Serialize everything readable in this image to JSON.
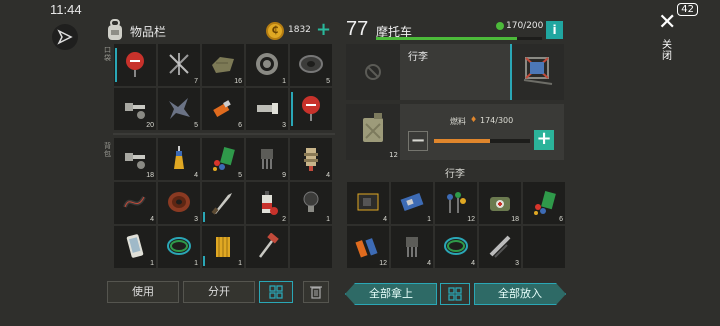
{
  "status": {
    "time": "11:44",
    "battery": "42"
  },
  "inventory": {
    "title": "物品栏",
    "coins": "1832",
    "label_pockets": "口袋",
    "label_backpack": "背包",
    "pockets": [
      {
        "icon": "stop-sign-icon",
        "count": ""
      },
      {
        "icon": "nails-icon",
        "count": "7"
      },
      {
        "icon": "cloth-icon",
        "count": "16"
      },
      {
        "icon": "bearing-icon",
        "count": "1"
      },
      {
        "icon": "tire-icon",
        "count": "5"
      },
      {
        "icon": "bolts-icon",
        "count": "20"
      },
      {
        "icon": "scrap-metal-icon",
        "count": "5"
      },
      {
        "icon": "usb-drive-icon",
        "count": "6"
      },
      {
        "icon": "flashlight-icon",
        "count": "3"
      },
      {
        "icon": "stop-sign-icon",
        "count": ""
      }
    ],
    "backpack": [
      {
        "icon": "bolts-icon",
        "count": "18"
      },
      {
        "icon": "glue-icon",
        "count": "4"
      },
      {
        "icon": "chemicals-icon",
        "count": "5"
      },
      {
        "icon": "transistor-icon",
        "count": "9"
      },
      {
        "icon": "engine-part-icon",
        "count": "4"
      },
      {
        "icon": "cable-icon",
        "count": "4"
      },
      {
        "icon": "copper-coil-icon",
        "count": "3"
      },
      {
        "icon": "machete-icon",
        "count": ""
      },
      {
        "icon": "spray-paint-icon",
        "count": "2"
      },
      {
        "icon": "light-bulb-icon",
        "count": "1"
      },
      {
        "icon": "smartphone-icon",
        "count": "1"
      },
      {
        "icon": "wire-icon",
        "count": "1"
      },
      {
        "icon": "filter-icon",
        "count": "1"
      },
      {
        "icon": "hammer-icon",
        "count": ""
      },
      {
        "icon": "",
        "count": ""
      }
    ],
    "buttons": {
      "use": "使用",
      "split": "分开"
    }
  },
  "vehicle": {
    "number": "77",
    "name": "摩托车",
    "durability": "170/200",
    "durability_level": 0.85,
    "luggage_label": "行李",
    "fuel_label": "燃料",
    "fuel_value": "174/300",
    "fuel_level": 0.58,
    "fuel_count": "12",
    "close_label": "关闭"
  },
  "luggage": {
    "title": "行李",
    "items": [
      {
        "icon": "circuit-board-icon",
        "count": "4"
      },
      {
        "icon": "blue-circuit-icon",
        "count": "1"
      },
      {
        "icon": "components-icon",
        "count": "12"
      },
      {
        "icon": "military-bag-icon",
        "count": "18"
      },
      {
        "icon": "chemicals-icon",
        "count": "6"
      },
      {
        "icon": "batteries-icon",
        "count": "12"
      },
      {
        "icon": "transistor-icon",
        "count": "4"
      },
      {
        "icon": "wire-icon",
        "count": "4"
      },
      {
        "icon": "multitool-icon",
        "count": "3"
      },
      {
        "icon": "",
        "count": ""
      }
    ],
    "take_all": "全部拿上",
    "put_all": "全部放入"
  },
  "colors": {
    "teal": "#2aa7b6",
    "green": "#4cba3a",
    "orange": "#e0862c",
    "coin": "#e0a823"
  }
}
